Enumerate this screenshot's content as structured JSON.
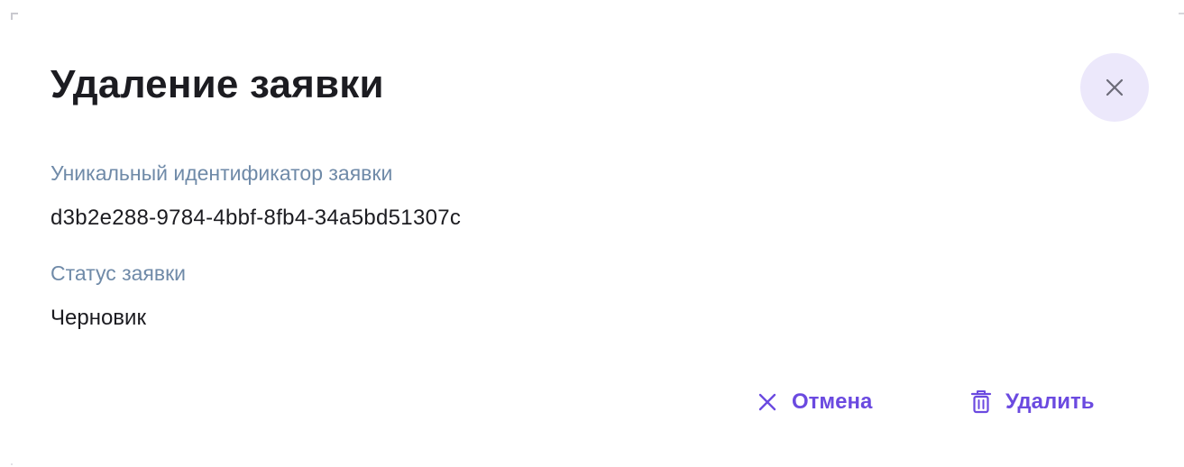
{
  "dialog": {
    "title": "Удаление заявки",
    "fields": [
      {
        "label": "Уникальный идентификатор заявки",
        "value": "d3b2e288-9784-4bbf-8fb4-34a5bd51307c"
      },
      {
        "label": "Статус заявки",
        "value": "Черновик"
      }
    ],
    "actions": {
      "cancel_label": "Отмена",
      "cancel_icon": "close-icon",
      "delete_label": "Удалить",
      "delete_icon": "trash-icon"
    },
    "close_icon": "close-icon"
  },
  "colors": {
    "accent": "#6b4ae0",
    "label": "#6f8aa8",
    "text": "#1c1c21",
    "close_bg": "#ece8fb"
  }
}
